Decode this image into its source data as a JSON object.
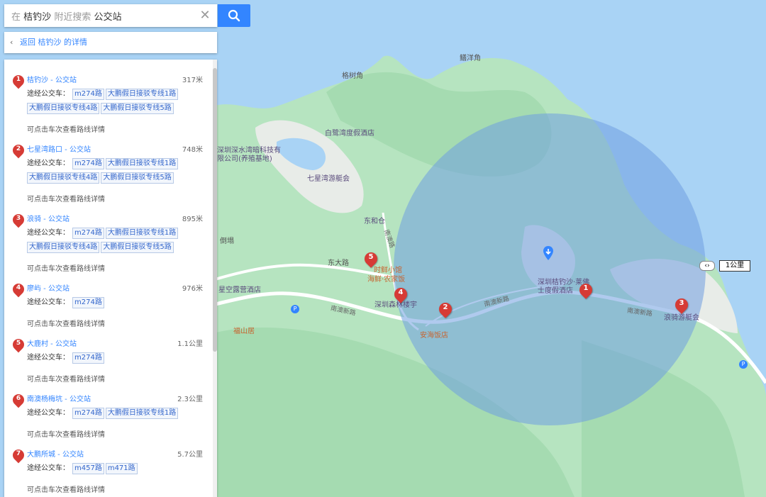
{
  "search": {
    "prefix": "在",
    "place": "桔钓沙",
    "mid": "附近搜索",
    "keyword": "公交站"
  },
  "back": {
    "label": "返回 桔钓沙 的详情"
  },
  "route_label": "途经公交车：",
  "hint": "可点击车次查看路线详情",
  "results": [
    {
      "num": "1",
      "name": "桔钓沙 - 公交站",
      "dist": "317米",
      "routes": [
        "m274路",
        "大鹏假日接驳专线1路",
        "大鹏假日接驳专线4路",
        "大鹏假日接驳专线5路"
      ]
    },
    {
      "num": "2",
      "name": "七星湾路口 - 公交站",
      "dist": "748米",
      "routes": [
        "m274路",
        "大鹏假日接驳专线1路",
        "大鹏假日接驳专线4路",
        "大鹏假日接驳专线5路"
      ]
    },
    {
      "num": "3",
      "name": "浪骑 - 公交站",
      "dist": "895米",
      "routes": [
        "m274路",
        "大鹏假日接驳专线1路",
        "大鹏假日接驳专线4路",
        "大鹏假日接驳专线5路"
      ]
    },
    {
      "num": "4",
      "name": "廖屿 - 公交站",
      "dist": "976米",
      "routes": [
        "m274路"
      ]
    },
    {
      "num": "5",
      "name": "大鹿村 - 公交站",
      "dist": "1.1公里",
      "routes": [
        "m274路"
      ]
    },
    {
      "num": "6",
      "name": "南澳杨梅坑 - 公交站",
      "dist": "2.3公里",
      "routes": [
        "m274路",
        "大鹏假日接驳专线1路"
      ]
    },
    {
      "num": "7",
      "name": "大鹏所城 - 公交站",
      "dist": "5.7公里",
      "routes": [
        "m457路",
        "m471路"
      ]
    }
  ],
  "map": {
    "scale_label": "1公里",
    "labels": {
      "l1": "鳝洋角",
      "l2": "格树角",
      "l3": "白鹭湾度假酒店",
      "l4": "深圳深水湾暗科技有限公司(养殖基地)",
      "l5": "七星湾游艇会",
      "l6": "东和仓",
      "l7": "倒塌",
      "l8": "东大路",
      "l9": "星空露营酒店",
      "l10": "福山居",
      "l11": "时鲜小馆",
      "l12": "海鲜·农家饭",
      "l13": "深圳森林楼宇",
      "l14": "安海饭店",
      "l15": "深圳桔钓沙·莱佛士度假酒店",
      "l16": "浪骑游艇会",
      "r1": "南澳新路",
      "r2": "南澳新路",
      "r3": "南澳新路",
      "r4": "南澳路"
    },
    "markers": [
      {
        "num": "1"
      },
      {
        "num": "2"
      },
      {
        "num": "3"
      },
      {
        "num": "4"
      },
      {
        "num": "5"
      }
    ],
    "colors": {
      "sea": "#a9d3f5",
      "land": "#b6e4c0",
      "hills": "#a5dbb1",
      "circle": "#6f9fe0",
      "marker": "#d63b35",
      "accent": "#3385ff"
    }
  }
}
